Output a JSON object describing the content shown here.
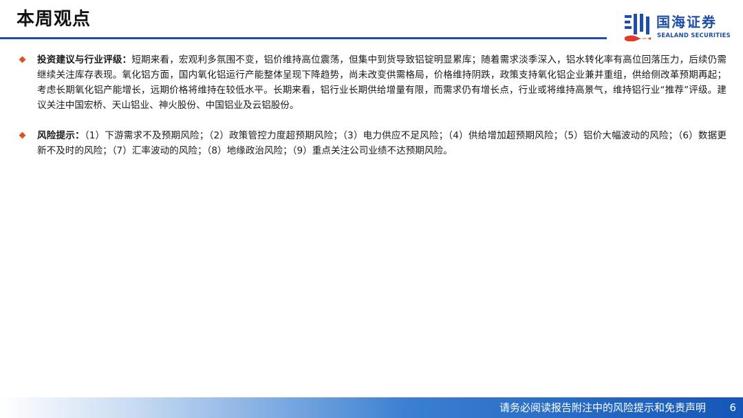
{
  "header": {
    "title": "本周观点"
  },
  "logo": {
    "name_cn": "国海证券",
    "name_en": "SEALAND SECURITIES",
    "brand_color": "#1e4fa8"
  },
  "bullets": [
    {
      "label": "投资建议与行业评级：",
      "text": "短期来看，宏观利多氛围不变，铝价维持高位震荡，但集中到货导致铝锭明显累库；随着需求淡季深入，铝水转化率有高位回落压力，后续仍需继续关注库存表现。氧化铝方面，国内氧化铝运行产能整体呈现下降趋势，尚未改变供需格局，价格维持阴跌，政策支持氧化铝企业兼并重组，供给侧改革预期再起；考虑长期氧化铝产能增长，远期价格将维持在较低水平。长期来看，铝行业长期供给增量有限，而需求仍有增长点，行业或将维持高景气，维持铝行业“推荐”评级。建议关注中国宏桥、天山铝业、神火股份、中国铝业及云铝股份。"
    },
    {
      "label": "风险提示：",
      "text": "（1）下游需求不及预期风险；（2）政策管控力度超预期风险；（3）电力供应不足风险；（4）供给增加超预期风险；（5）铝价大幅波动的风险；（6）数据更新不及时的风险；（7）汇率波动的风险；（8）地缘政治风险；（9）重点关注公司业绩不达预期风险。"
    }
  ],
  "footer": {
    "disclaimer": "请务必阅读报告附注中的风险提示和免责声明",
    "page_number": "6"
  },
  "colors": {
    "accent": "#1e4fa8",
    "bullet": "#d9541e"
  }
}
